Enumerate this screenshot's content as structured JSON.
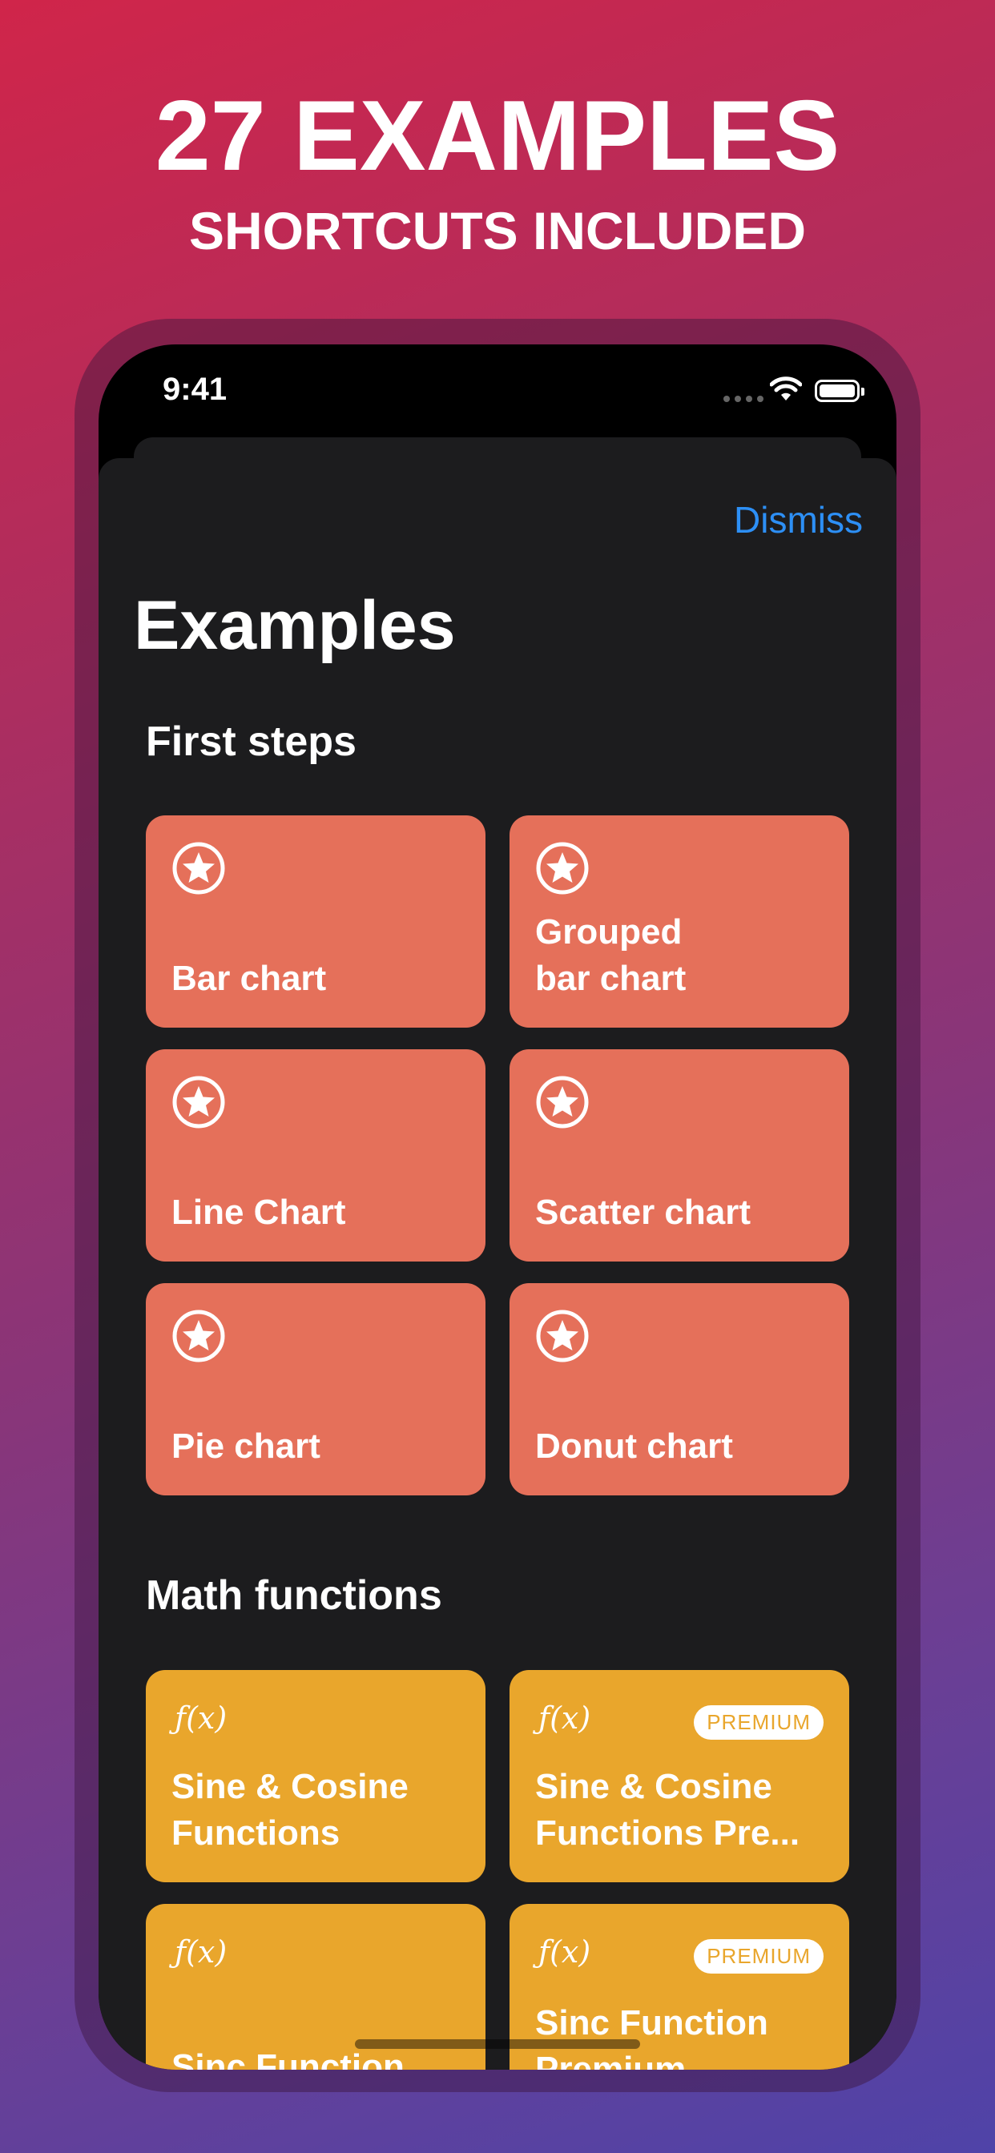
{
  "promo": {
    "headline": "27 EXAMPLES",
    "subheadline": "SHORTCUTS INCLUDED"
  },
  "status_bar": {
    "time": "9:41"
  },
  "sheet": {
    "dismiss_label": "Dismiss",
    "title": "Examples"
  },
  "sections": [
    {
      "title": "First steps",
      "items": [
        {
          "label": "Bar chart",
          "icon": "star-circle-icon"
        },
        {
          "label": "Grouped bar chart",
          "icon": "star-circle-icon"
        },
        {
          "label": "Line Chart",
          "icon": "star-circle-icon"
        },
        {
          "label": "Scatter chart",
          "icon": "star-circle-icon"
        },
        {
          "label": "Pie chart",
          "icon": "star-circle-icon"
        },
        {
          "label": "Donut chart",
          "icon": "star-circle-icon"
        }
      ]
    },
    {
      "title": "Math functions",
      "items": [
        {
          "label": "Sine & Cosine Functions",
          "icon": "fx",
          "badge": ""
        },
        {
          "label": "Sine & Cosine Functions Pre...",
          "icon": "fx",
          "badge": "PREMIUM"
        },
        {
          "label": "Sinc Function",
          "icon": "fx",
          "badge": ""
        },
        {
          "label": "Sinc Function Premium",
          "icon": "fx",
          "badge": "PREMIUM"
        }
      ]
    }
  ],
  "colors": {
    "first_steps_card": "#e5705a",
    "math_card": "#e9a62c",
    "accent": "#2d8ff5",
    "sheet_bg": "#1c1c1e"
  }
}
